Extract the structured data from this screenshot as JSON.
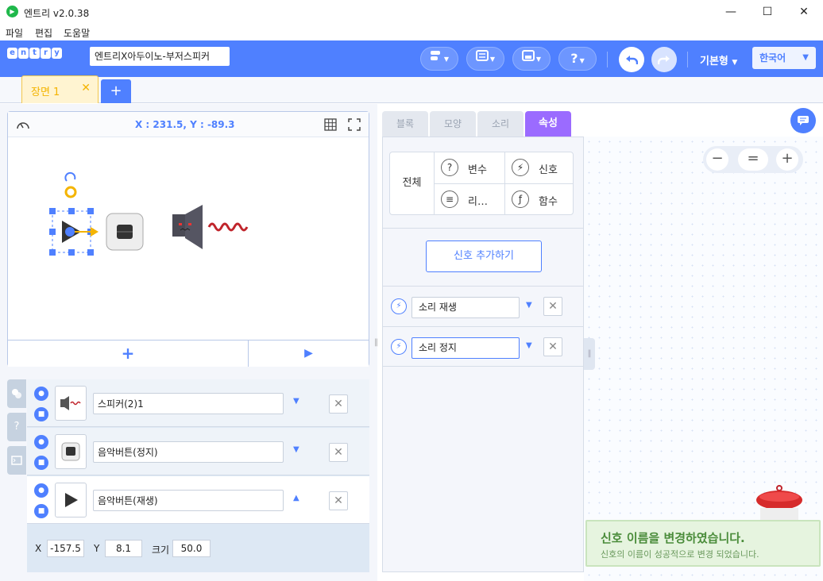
{
  "window": {
    "title": "엔트리 v2.0.38",
    "minimize_glyph": "—",
    "maximize_glyph": "☐",
    "close_glyph": "✕"
  },
  "menu": {
    "items": [
      "파일",
      "편집",
      "도움말"
    ]
  },
  "topbar": {
    "logo_letters": [
      "e",
      "n",
      "t",
      "r",
      "y"
    ],
    "project_title": "엔트리X아두이노-부저스피커",
    "mode_label": "기본형",
    "language": "한국어",
    "help_glyph": "?"
  },
  "scene": {
    "tab_label": "장면 1",
    "add_glyph": "+"
  },
  "stage": {
    "coords": "X : 231.5, Y : -89.3",
    "add_glyph": "+",
    "play_glyph": "▶"
  },
  "objects": [
    {
      "name": "스피커(2)1",
      "icon": "speaker-icon"
    },
    {
      "name": "음악버튼(정지)",
      "icon": "stop-button-icon"
    },
    {
      "name": "음악버튼(재생)",
      "icon": "play-button-icon"
    }
  ],
  "object_props": {
    "x_label": "X",
    "x_value": "-157.5",
    "y_label": "Y",
    "y_value": "8.1",
    "size_label": "크기",
    "size_value": "50.0"
  },
  "tabs": [
    "블록",
    "모양",
    "소리",
    "속성"
  ],
  "attributes": {
    "all_label": "전체",
    "categories": [
      {
        "label": "변수",
        "icon": "question-icon"
      },
      {
        "label": "신호",
        "icon": "signal-icon"
      },
      {
        "label": "리…",
        "icon": "list-icon"
      },
      {
        "label": "함수",
        "icon": "function-icon"
      }
    ],
    "add_signal_label": "신호 추가하기",
    "signals": [
      {
        "name": "소리 재생"
      },
      {
        "name": "소리 정지"
      }
    ]
  },
  "zoom": {
    "out": "−",
    "reset": "=",
    "in": "+"
  },
  "toast": {
    "title": "신호 이름을 변경하였습니다.",
    "message": "신호의 이름이 성공적으로 변경 되었습니다."
  },
  "colors": {
    "brand_blue": "#4f80ff",
    "attr_tab": "#9b6bff",
    "scene_tab": "#f4b400",
    "toast_green": "#4a8c3a"
  }
}
